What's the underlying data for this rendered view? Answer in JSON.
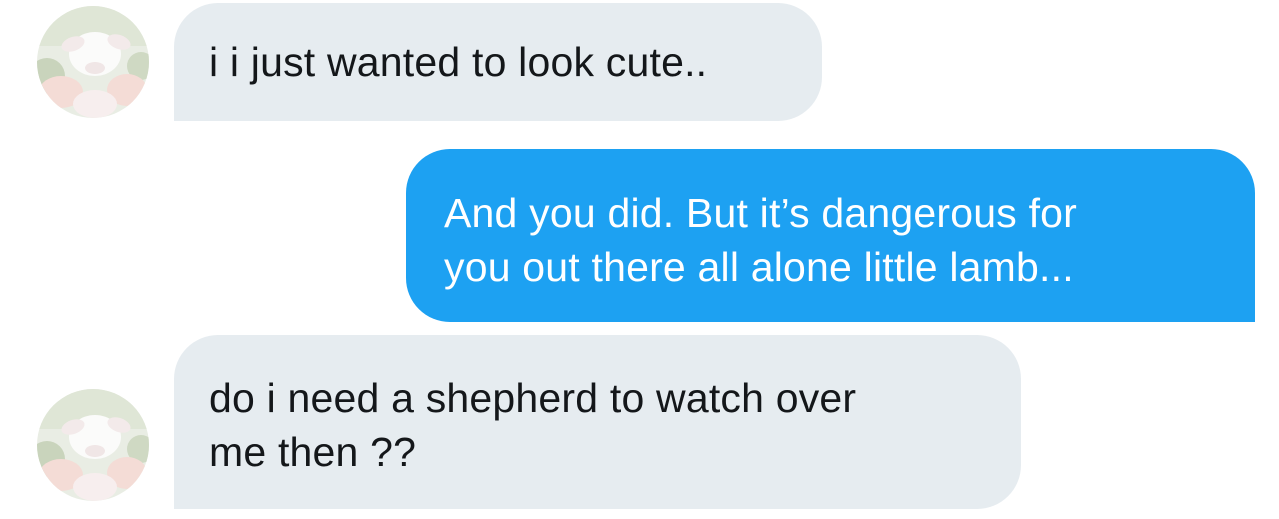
{
  "colors": {
    "incoming_bubble": "#e6ecf0",
    "outgoing_bubble": "#1da1f2",
    "incoming_text": "#14171a",
    "outgoing_text": "#ffffff"
  },
  "messages": [
    {
      "direction": "incoming",
      "lines": [
        "i i just wanted to look cute.."
      ],
      "avatar_icon": "lamb-avatar"
    },
    {
      "direction": "outgoing",
      "lines": [
        "And you did. But it’s dangerous for",
        "you out there all alone little lamb..."
      ]
    },
    {
      "direction": "incoming",
      "lines": [
        "do i need a shepherd to watch over",
        "me then ??"
      ],
      "avatar_icon": "lamb-avatar"
    }
  ]
}
